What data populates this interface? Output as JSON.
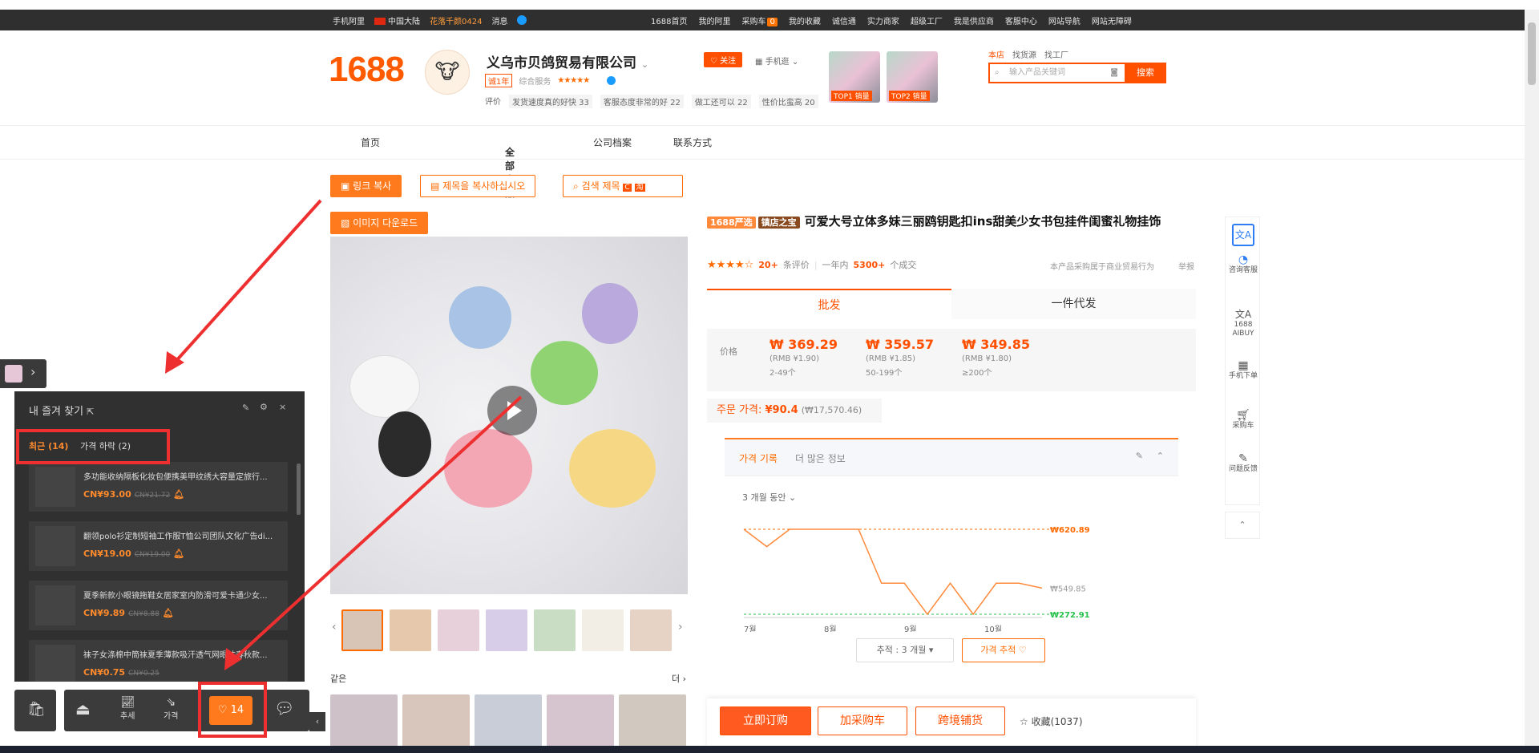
{
  "topbar": {
    "mobile": "手机阿里",
    "region": "中国大陆",
    "promo": "花落千颜0424",
    "messages": "消息",
    "home": "1688首页",
    "my_ali": "我的阿里",
    "cart": "采购车",
    "cart_count": "0",
    "favorites": "我的收藏",
    "trust": "诚信通",
    "power_merchant": "实力商家",
    "super_factory": "超级工厂",
    "supplier": "我是供应商",
    "service": "客服中心",
    "site_nav": "网站导航",
    "accessible": "网站无障碍"
  },
  "header": {
    "logo": "1688",
    "shop_name": "义乌市贝鸽贸易有限公司",
    "year_badge": "诚1年",
    "service_label": "综合服务",
    "service_stars": "★★★★★",
    "eval_label": "评价",
    "eval_tags": [
      "发货速度真的好快 33",
      "客服态度非常的好 22",
      "做工还可以 22",
      "性价比蛮高 20"
    ],
    "follow": "关注",
    "mobile_shop": "手机逛",
    "top_items": [
      "TOP1 销量",
      "TOP2 销量"
    ],
    "search_tabs": [
      "本店",
      "找货源",
      "找工厂"
    ],
    "search_placeholder": "输入产品关键词",
    "search_btn": "搜索"
  },
  "nav": [
    "首页",
    "全部商品",
    "公司档案",
    "联系方式"
  ],
  "tools": {
    "copy_link": "링크 복사",
    "copy_title": "제목을 복사하십시오",
    "search_title": "검색 제목",
    "download_image": "이미지 다운로드"
  },
  "product": {
    "tag1": "1688严选",
    "tag2": "镇店之宝",
    "title": "可爱大号立体多妹三丽鸥钥匙扣ins甜美少女书包挂件闺蜜礼物挂饰",
    "review_count": "20+",
    "review_label": "条评价",
    "sales_prefix": "一年内",
    "sales": "5300+",
    "sales_suffix": "个成交",
    "notice": "本产品采购属于商业贸易行为",
    "report": "举报",
    "tab_wholesale": "批发",
    "tab_dropship": "一件代发",
    "price_label": "价格",
    "prices": [
      {
        "krw": "₩ 369.29",
        "rmb": "(RMB ¥1.90)",
        "range": "2-49个"
      },
      {
        "krw": "₩ 359.57",
        "rmb": "(RMB ¥1.85)",
        "range": "50-199个"
      },
      {
        "krw": "₩ 349.85",
        "rmb": "(RMB ¥1.80)",
        "range": "≥200个"
      }
    ],
    "order_price_label": "주문 가격:",
    "order_price": "¥90.4",
    "order_price_krw": "(₩17,570.46)"
  },
  "history": {
    "tab_active": "가격 기록",
    "tab_more": "더 많은 정보",
    "period": "3 개월 동안",
    "track_period": "추적 : 3 개월",
    "track_btn": "가격 추적",
    "high_label": "₩620.89",
    "current_label": "₩549.85",
    "low_label": "₩272.91"
  },
  "chart_data": {
    "type": "line",
    "title": "",
    "xlabel": "",
    "ylabel": "",
    "x_ticks": [
      "7월",
      "8월",
      "9월",
      "10월"
    ],
    "ylim": [
      272.91,
      620.89
    ],
    "series": [
      {
        "values": [
          620.89,
          549.85,
          620.89,
          620.89,
          620.89,
          620.89,
          400,
          400,
          272.91,
          400,
          272.91,
          400,
          400,
          380
        ]
      }
    ]
  },
  "same": {
    "label": "같은",
    "more": "더"
  },
  "buybar": {
    "order_now": "立即订购",
    "add_cart": "加采购车",
    "cross_border": "跨境铺货",
    "collect": "收藏(1037)"
  },
  "right_side": [
    "咨询客服",
    "1688 AIBUY",
    "手机下单",
    "采购车",
    "问题反馈"
  ],
  "panel": {
    "title": "내 즐겨 찾기",
    "tab_recent": "최근 (14)",
    "tab_drop": "가격 하락 (2)",
    "items": [
      {
        "name": "多功能收纳隔板化妆包便携美甲纹绣大容量定旅行...",
        "price": "CN¥93.00",
        "old": "CN¥21.72"
      },
      {
        "name": "翻领polo衫定制短袖工作服T恤公司团队文化广告di...",
        "price": "CN¥19.00",
        "old": "CN¥19.00"
      },
      {
        "name": "夏季新款小眼镜拖鞋女居家室内防滑可爱卡通少女...",
        "price": "CN¥9.89",
        "old": "CN¥8.88"
      },
      {
        "name": "袜子女涤棉中筒袜夏季薄款吸汗透气网眼袜春秋款...",
        "price": "CN¥0.75",
        "old": "CN¥0.25"
      }
    ]
  },
  "toolbar": {
    "trend": "추세",
    "price": "가격",
    "fav_count": "14"
  }
}
